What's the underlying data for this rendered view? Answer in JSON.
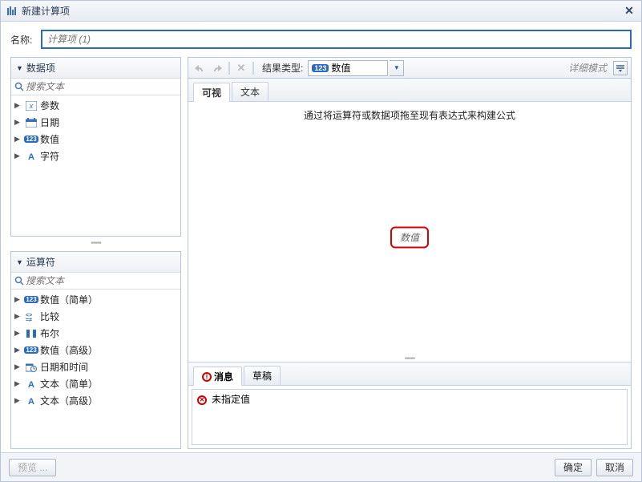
{
  "window": {
    "title": "新建计算项",
    "name_label": "名称:",
    "name_placeholder": "计算项 (1)"
  },
  "left": {
    "data_items": {
      "header": "数据项",
      "search_placeholder": "搜索文本",
      "items": [
        {
          "label": "参数",
          "icon": "param"
        },
        {
          "label": "日期",
          "icon": "date"
        },
        {
          "label": "数值",
          "icon": "numeric"
        },
        {
          "label": "字符",
          "icon": "char"
        }
      ]
    },
    "operators": {
      "header": "运算符",
      "search_placeholder": "搜索文本",
      "items": [
        {
          "label": "数值（简单）",
          "icon": "numeric"
        },
        {
          "label": "比较",
          "icon": "compare"
        },
        {
          "label": "布尔",
          "icon": "bool"
        },
        {
          "label": "数值（高级）",
          "icon": "numeric"
        },
        {
          "label": "日期和时间",
          "icon": "datetime"
        },
        {
          "label": "文本（简单）",
          "icon": "text"
        },
        {
          "label": "文本（高级）",
          "icon": "text"
        }
      ]
    }
  },
  "toolbar": {
    "result_label": "结果类型:",
    "result_value": "数值",
    "detail_mode": "详细模式"
  },
  "tabs": {
    "visual": "可视",
    "text": "文本"
  },
  "expression": {
    "hint": "通过将运算符或数据项拖至现有表达式来构建公式",
    "drop_label": "数值"
  },
  "messages": {
    "tab_messages": "消息",
    "tab_draft": "草稿",
    "rows": [
      {
        "text": "未指定值"
      }
    ]
  },
  "footer": {
    "preview": "预览 ...",
    "ok": "确定",
    "cancel": "取消"
  }
}
